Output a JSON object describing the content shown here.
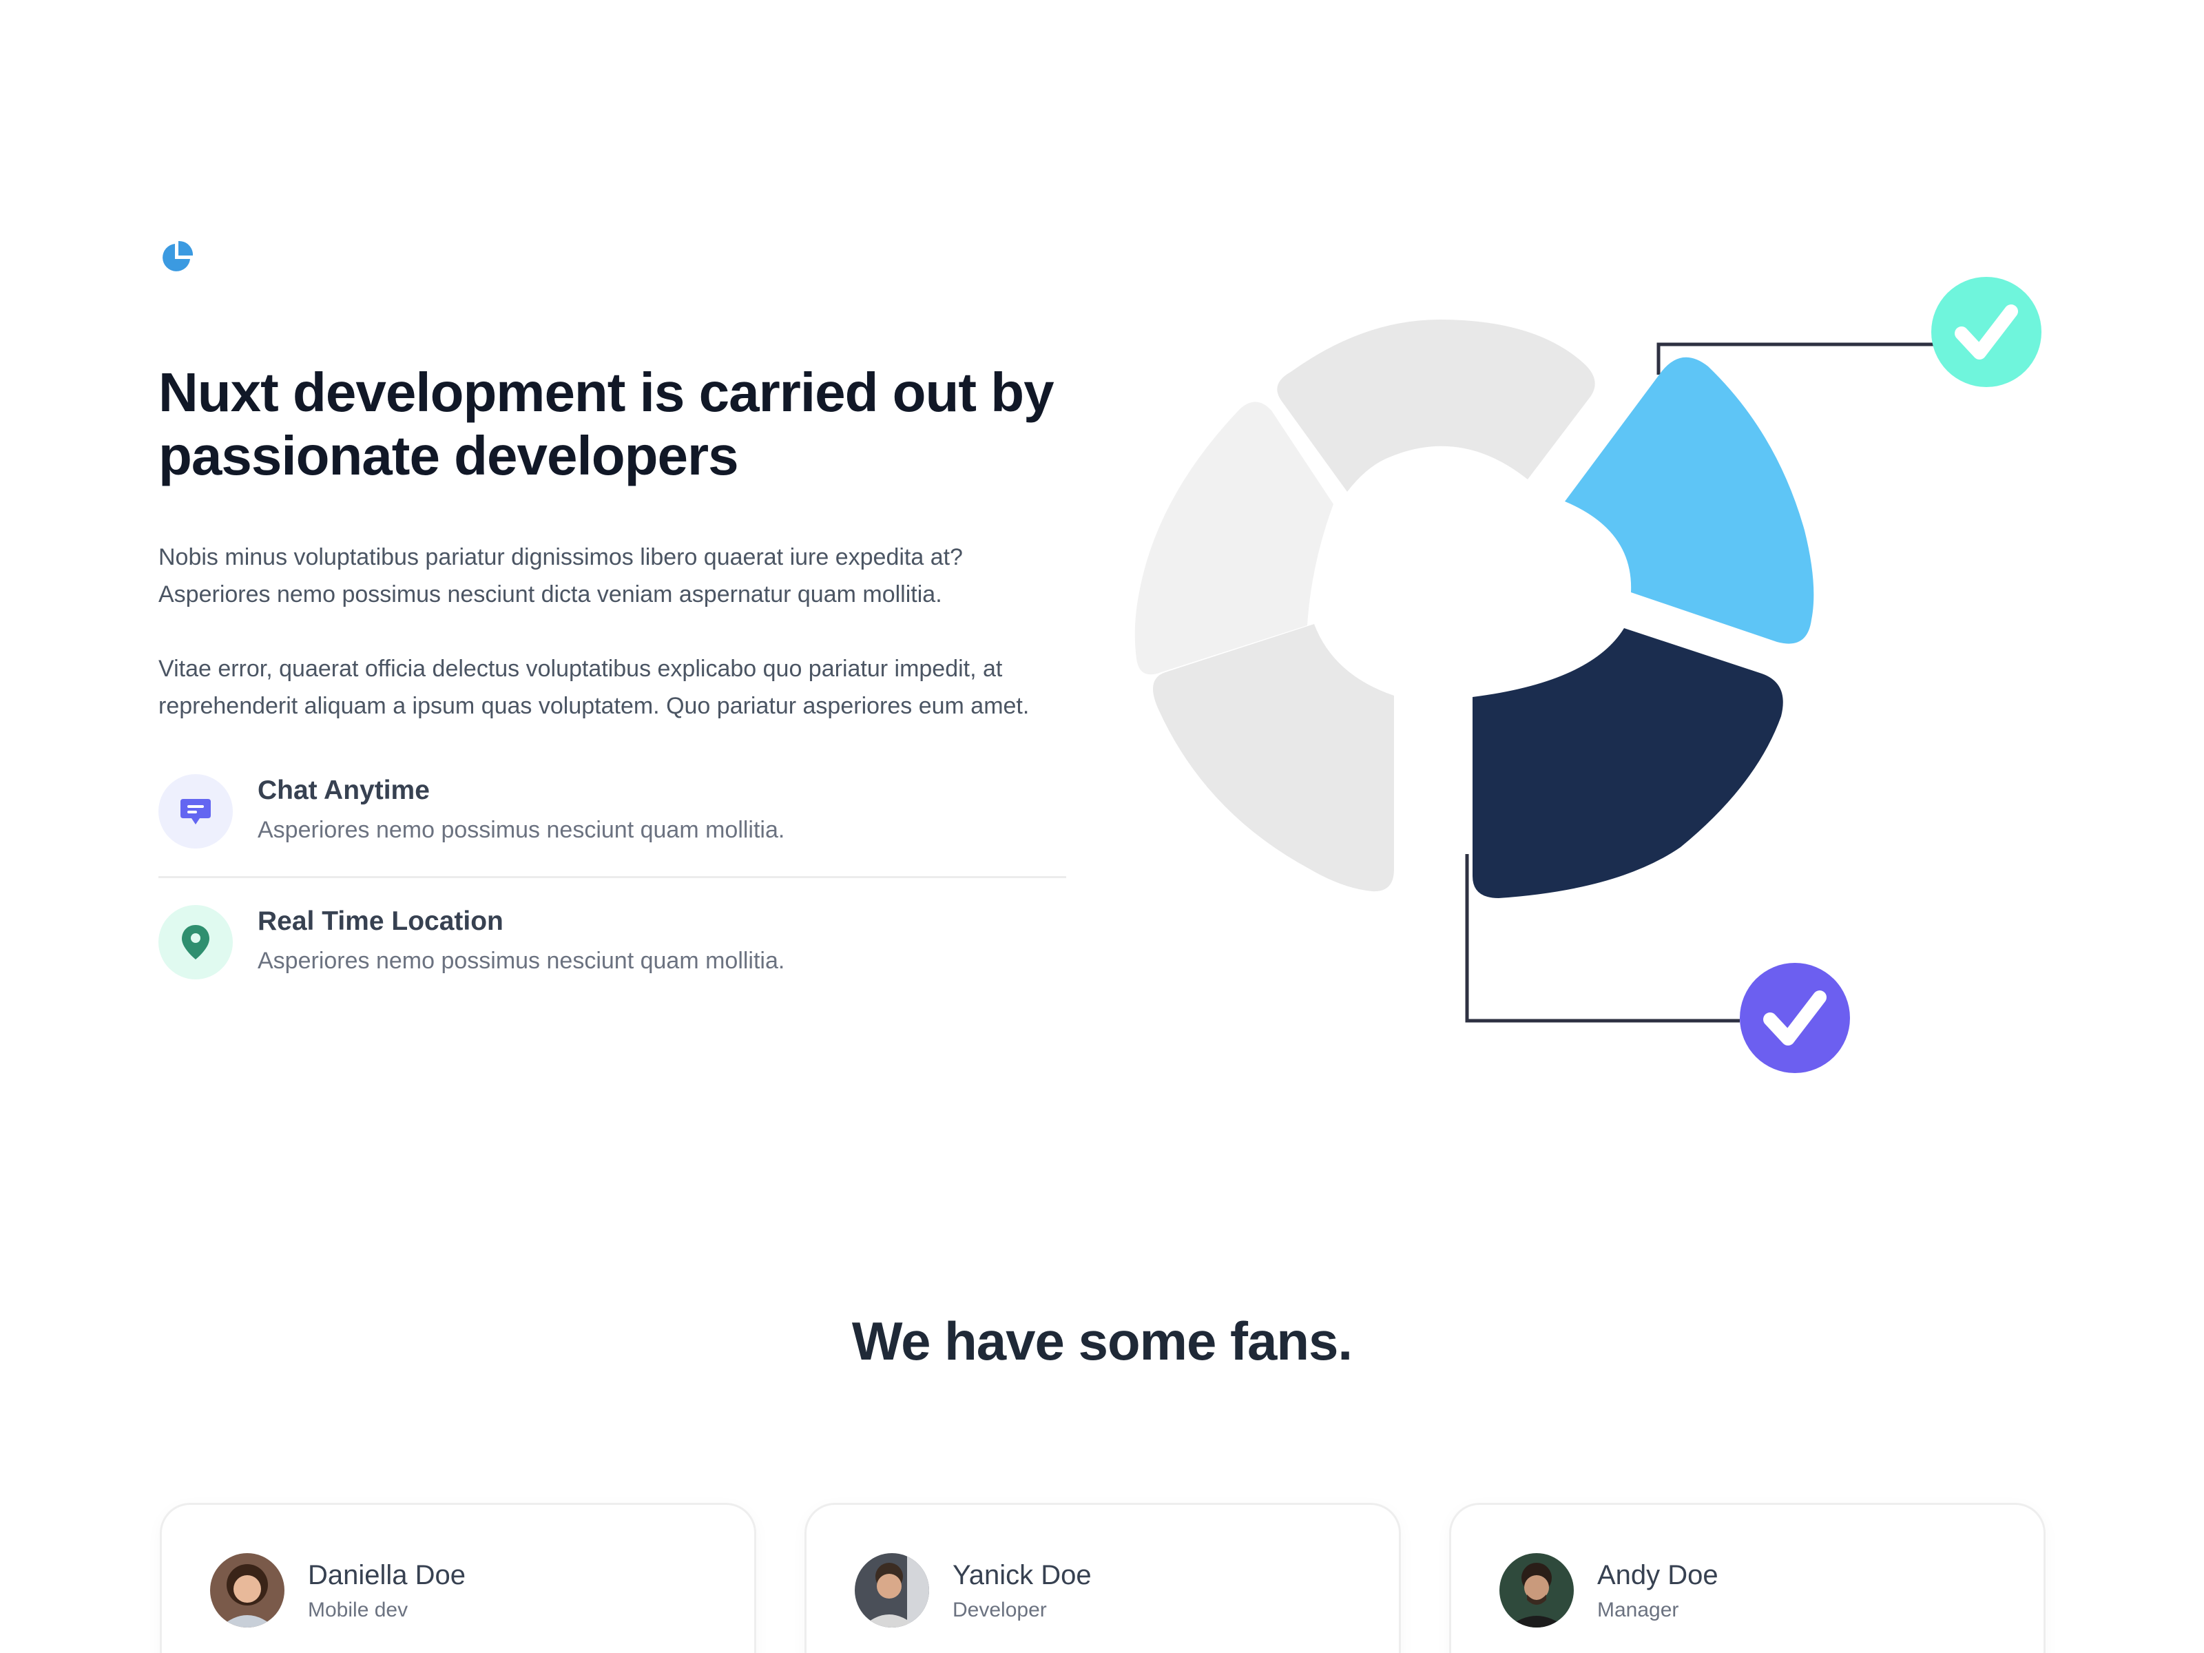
{
  "hero": {
    "title_line1": "Nuxt development is carried out by",
    "title_line2": "passionate developers",
    "paragraph1_line1": "Nobis minus voluptatibus pariatur dignissimos libero quaerat iure expedita at?",
    "paragraph1_line2": "Asperiores nemo possimus nesciunt dicta veniam aspernatur quam mollitia.",
    "paragraph2_line1": "Vitae error, quaerat officia delectus voluptatibus explicabo quo pariatur impedit, at",
    "paragraph2_line2": "reprehenderit aliquam a ipsum quas voluptatem. Quo pariatur asperiores eum amet."
  },
  "features": [
    {
      "title": "Chat Anytime",
      "text": "Asperiores nemo possimus nesciunt quam mollitia.",
      "icon": "chat-icon",
      "color": "#6366f1",
      "bg": "#eef0fd"
    },
    {
      "title": "Real Time Location",
      "text": "Asperiores nemo possimus nesciunt quam mollitia.",
      "icon": "location-pin-icon",
      "color": "#2f8f6f",
      "bg": "#e0faf0"
    }
  ],
  "colors": {
    "logo": "#3b9ae1",
    "segment_light_blue": "#5ec5f6",
    "segment_navy": "#1b2d4f",
    "segment_gray": "#e8e8e8",
    "segment_gray_light": "#f1f1f1",
    "check_teal": "#6ff5dc",
    "check_purple": "#6c5ff0",
    "connector": "#2e3142"
  },
  "fans": {
    "title": "We have some fans.",
    "cards": [
      {
        "name": "Daniella Doe",
        "role": "Mobile dev"
      },
      {
        "name": "Yanick Doe",
        "role": "Developer"
      },
      {
        "name": "Andy Doe",
        "role": "Manager"
      }
    ]
  }
}
